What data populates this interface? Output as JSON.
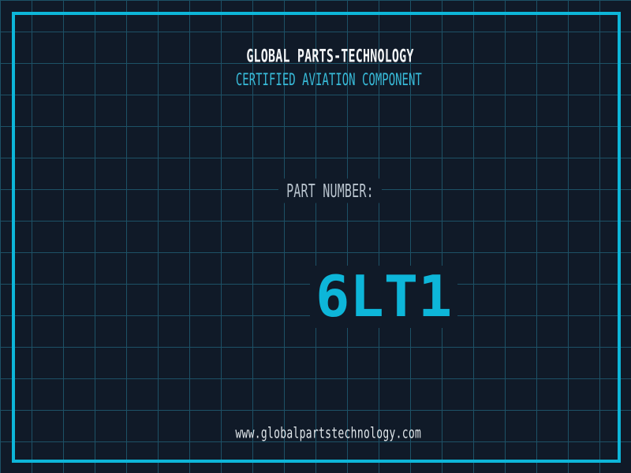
{
  "header": {
    "company_name": "GLOBAL PARTS-TECHNOLOGY",
    "tagline": "CERTIFIED AVIATION COMPONENT"
  },
  "part": {
    "label": "PART NUMBER:",
    "number": "6LT1"
  },
  "footer": {
    "website": "www.globalpartstechnology.com"
  },
  "colors": {
    "background": "#101a28",
    "grid_line": "#1d5166",
    "frame_cyan": "#0db6d9",
    "part_number_cyan": "#0db6d9",
    "tagline_cyan": "#38bbd9",
    "company_white": "#f2f4f6",
    "label_gray": "#b9c4ce",
    "url_white": "#e2e8ec"
  }
}
